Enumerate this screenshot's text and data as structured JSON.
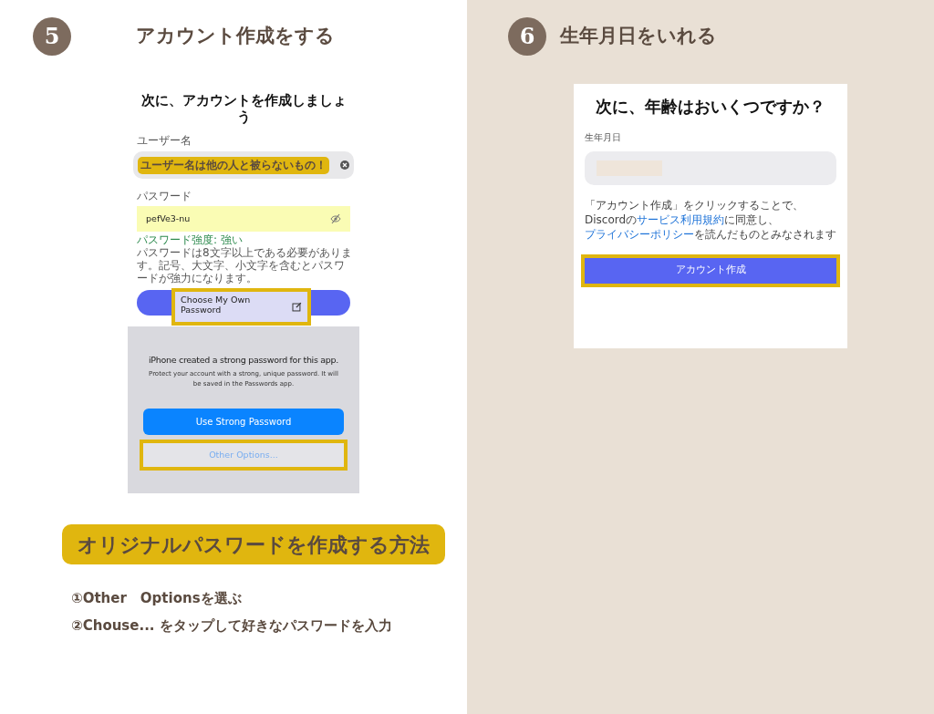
{
  "steps": [
    {
      "number": "5",
      "title": "アカウント作成をする",
      "screen": {
        "kind": "signup",
        "heading": "次に、アカウントを作成しましょう",
        "username_label": "ユーザー名",
        "username_value": {
          "text": "ユーザー名は他の人と被らないもの！",
          "highlighted": true
        },
        "password_label": "パスワード",
        "password_value": "pefVe3-nu",
        "strength": "パスワード強度: 強い",
        "hint": "パスワードは8文字以上である必要があります。記号、大文字、小文字を含むとパスワードが強力になります。",
        "popup": {
          "text": "Choose My Own Password",
          "highlighted": true
        },
        "sheet_title": "iPhone created a strong password for this app.",
        "sheet_text": "Protect your account with a strong, unique password. It will be saved in the Passwords app.",
        "primary_button": {
          "text": "Use Strong Password",
          "highlighted": false
        },
        "secondary_button": {
          "text": "Other Options...",
          "highlighted": true
        }
      },
      "callout": "オリジナルパスワードを作成する方法",
      "instructions": [
        "①Other　Optionsを選ぶ",
        "②Chouse... をタップして好きなパスワードを入力"
      ]
    },
    {
      "number": "6",
      "title": "生年月日をいれる",
      "screen": {
        "kind": "birthday",
        "heading": "次に、年齢はおいくつですか？",
        "label": "生年月日",
        "terms": [
          {
            "text": "「アカウント作成」をクリックすることで、Discordの",
            "link": false
          },
          {
            "text": "サービス利用規約",
            "link": true
          },
          {
            "text": "に同意し、",
            "link": false
          },
          {
            "text": "プライバシーポリシー",
            "link": true
          },
          {
            "text": "を読んだものとみなされます",
            "link": false
          }
        ],
        "button": {
          "text": "アカウント作成",
          "highlighted": true
        }
      }
    }
  ]
}
